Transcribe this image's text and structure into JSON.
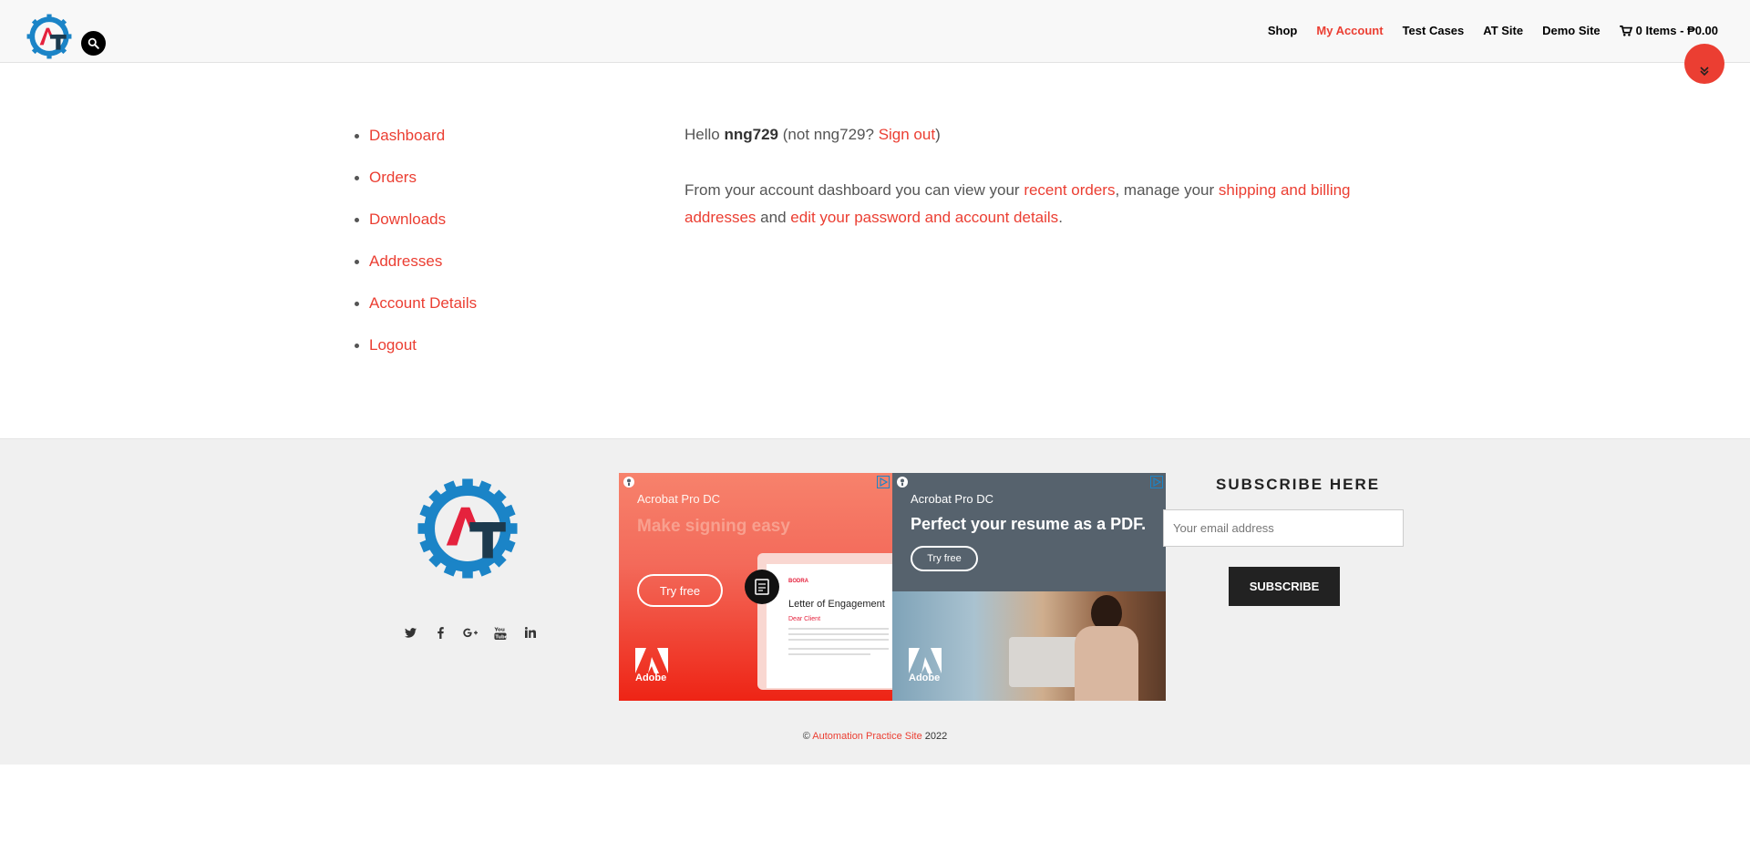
{
  "header": {
    "nav": [
      "Shop",
      "My Account",
      "Test Cases",
      "AT Site",
      "Demo Site"
    ],
    "cart_label": "0 Items - ₱0.00",
    "accent": "#eb3e32"
  },
  "account_nav": [
    "Dashboard",
    "Orders",
    "Downloads",
    "Addresses",
    "Account Details",
    "Logout"
  ],
  "content": {
    "hello": "Hello",
    "username": "nng729",
    "not_user": "(not nng729?",
    "sign_out": "Sign out",
    "close_paren": ")",
    "intro": "From your account dashboard you can view your",
    "recent_orders": "recent orders",
    "manage": ", manage your",
    "shipping_billing": "shipping and billing addresses",
    "and": "and",
    "edit_account": "edit your password and account details",
    "period": "."
  },
  "ads": {
    "ad1": {
      "product": "Acrobat Pro DC",
      "headline": "Make signing easy",
      "cta": "Try free",
      "doc_brand": "BODRA",
      "doc_title": "Letter of Engagement",
      "doc_salutation": "Dear Client",
      "brand": "Adobe"
    },
    "ad2": {
      "product": "Acrobat Pro DC",
      "headline": "Perfect your resume as a PDF.",
      "cta": "Try free",
      "brand": "Adobe"
    }
  },
  "subscribe": {
    "title": "SUBSCRIBE HERE",
    "placeholder": "Your email address",
    "button": "SUBSCRIBE"
  },
  "footer": {
    "copyright_prefix": "©",
    "site_name": "Automation Practice Site",
    "year": "2022"
  }
}
